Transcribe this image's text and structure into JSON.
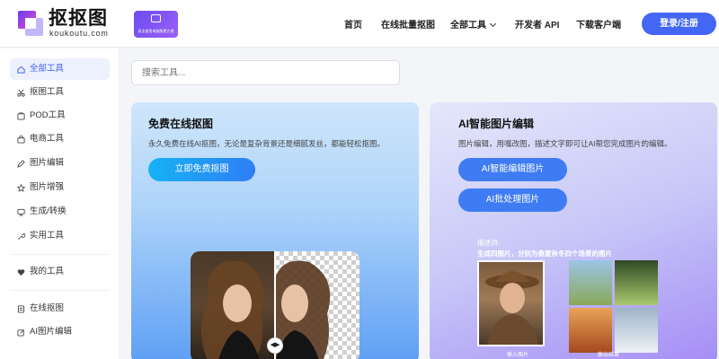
{
  "header": {
    "logo_text": "抠抠图",
    "logo_sub": "koukoutu.com",
    "promo_text": "双击使用电脑版更方便",
    "nav": [
      {
        "label": "首页"
      },
      {
        "label": "在线批量抠图"
      },
      {
        "label": "全部工具"
      },
      {
        "label": "开发者 API"
      },
      {
        "label": "下载客户端"
      }
    ],
    "login_label": "登录/注册"
  },
  "sidebar": {
    "items": [
      {
        "label": "全部工具",
        "icon": "home-icon",
        "active": true
      },
      {
        "label": "抠图工具",
        "icon": "scissors-icon"
      },
      {
        "label": "POD工具",
        "icon": "pod-icon"
      },
      {
        "label": "电商工具",
        "icon": "shopping-bag-icon"
      },
      {
        "label": "图片编辑",
        "icon": "pen-icon"
      },
      {
        "label": "图片增强",
        "icon": "star-icon"
      },
      {
        "label": "生成/转换",
        "icon": "monitor-icon"
      },
      {
        "label": "实用工具",
        "icon": "wrench-icon"
      }
    ],
    "my_tools": {
      "label": "我的工具",
      "icon": "heart-icon"
    },
    "bottom_items": [
      {
        "label": "在线抠图",
        "icon": "document-icon"
      },
      {
        "label": "AI图片编辑",
        "icon": "edit-icon"
      }
    ]
  },
  "search": {
    "placeholder": "搜索工具..."
  },
  "cards": {
    "left": {
      "title": "免费在线抠图",
      "desc": "永久免费在线AI抠图，无论是复杂背景还是细腻发丝，都能轻松抠图。",
      "button": "立即免费抠图"
    },
    "right": {
      "title": "AI智能图片编辑",
      "desc": "图片编辑，用嘴改图，描述文字即可让AI帮您完成图片的编辑。",
      "button1": "AI智能编辑图片",
      "button2": "AI批处理图片",
      "prompt_label": "描述词:",
      "prompt_text": "生成四图片，分别为春夏秋冬四个场景的图片",
      "caption_in": "输入图片",
      "caption_out": "输出结果"
    }
  },
  "colors": {
    "accent": "#4366f5",
    "active_bg": "#edf0fd"
  }
}
